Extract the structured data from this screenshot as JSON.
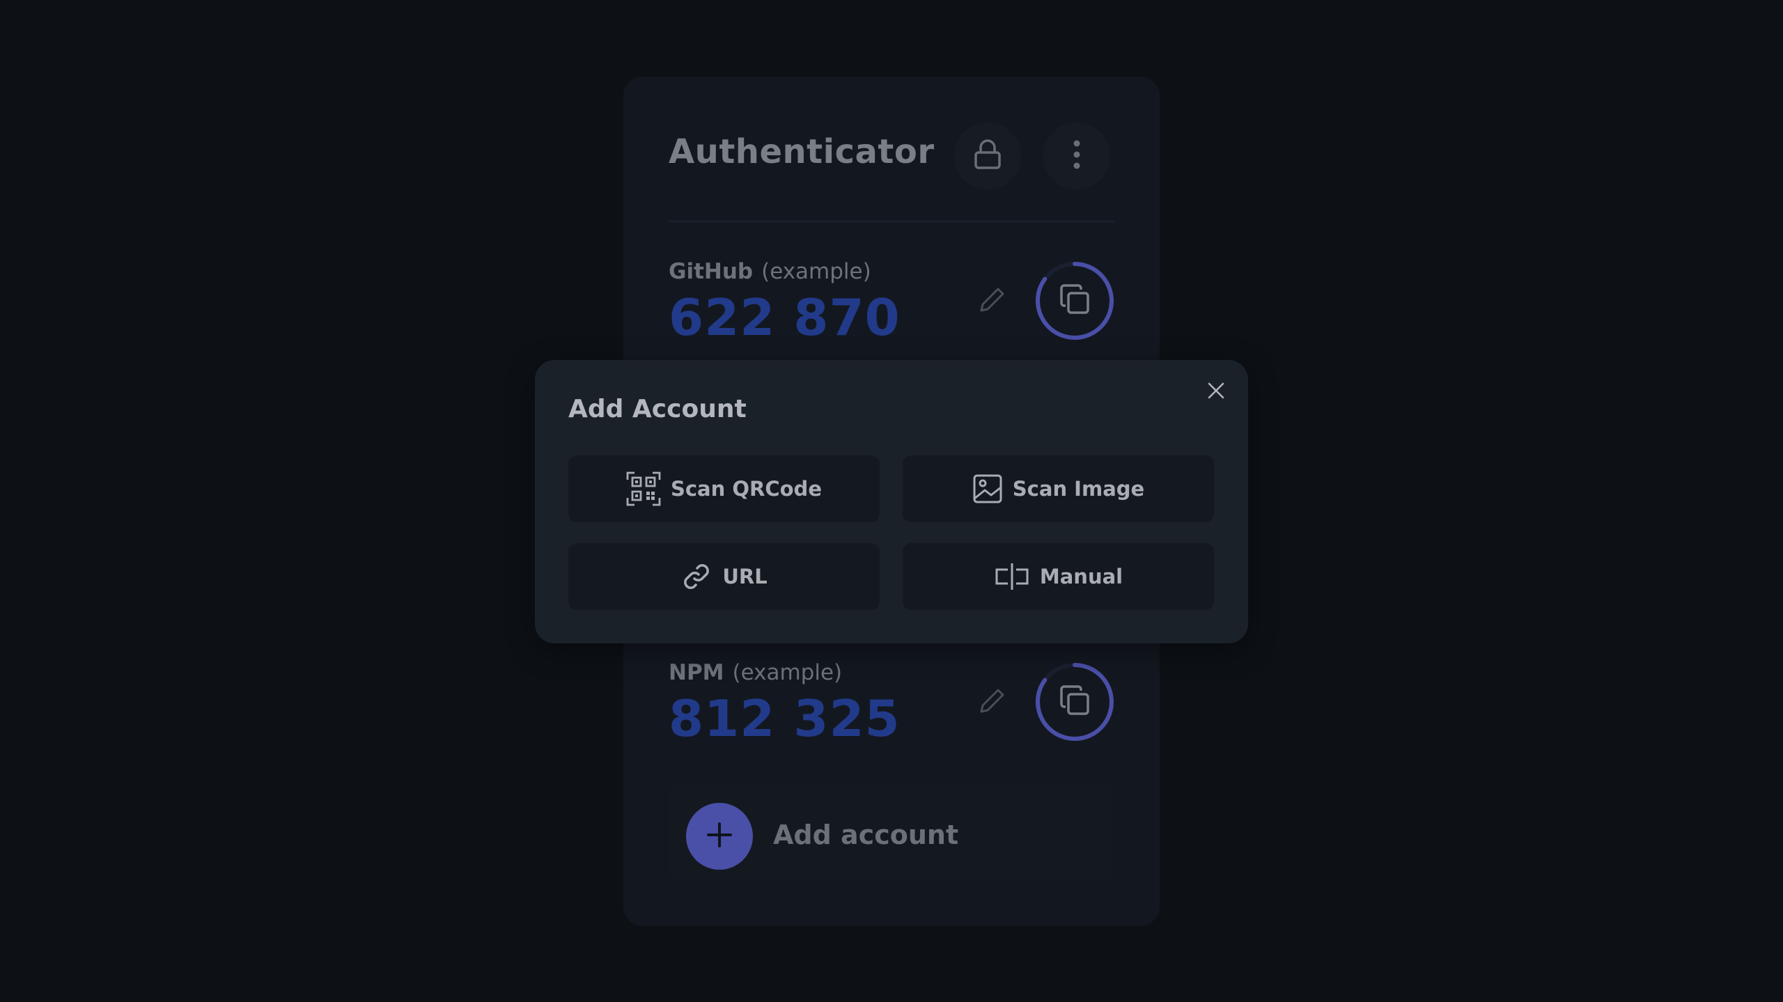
{
  "app": {
    "title": "Authenticator",
    "lock_icon": "lock-icon",
    "menu_icon": "more-vertical-icon"
  },
  "accounts": [
    {
      "issuer": "GitHub",
      "label": "(example)",
      "code": "622 870",
      "progress": 0.85
    },
    {
      "issuer": "NPM",
      "label": "(example)",
      "code": "812 325",
      "progress": 0.85
    }
  ],
  "add_account": {
    "label": "Add account",
    "icon": "plus-icon"
  },
  "dialog": {
    "title": "Add Account",
    "close_icon": "close-icon",
    "options": [
      {
        "label": "Scan QRCode",
        "icon": "qrcode-scan-icon"
      },
      {
        "label": "Scan Image",
        "icon": "image-icon"
      },
      {
        "label": "URL",
        "icon": "link-icon"
      },
      {
        "label": "Manual",
        "icon": "text-cursor-icon"
      }
    ]
  },
  "colors": {
    "background": "#0d1116",
    "card": "#131820",
    "dialog": "#1b2129",
    "code": "#223a8a",
    "accent": "#4a4fa8"
  }
}
